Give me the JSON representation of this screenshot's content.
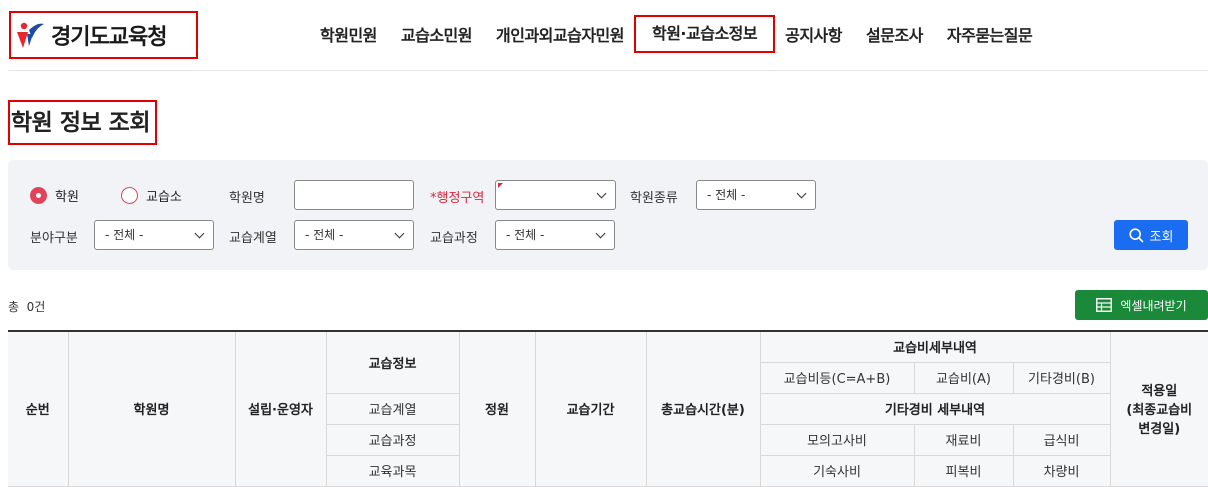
{
  "header": {
    "logo_text": "경기도교육청",
    "nav": [
      "학원민원",
      "교습소민원",
      "개인과외교습자민원",
      "학원·교습소정보",
      "공지사항",
      "설문조사",
      "자주묻는질문"
    ],
    "active_nav_index": 3
  },
  "page_title": "학원 정보 조회",
  "search": {
    "radio_academy": "학원",
    "radio_tutoring": "교습소",
    "selected_radio": "학원",
    "academy_name_label": "학원명",
    "academy_name_value": "",
    "district_label": "*행정구역",
    "district_value": "",
    "academy_type_label": "학원종류",
    "academy_type_value": "- 전체 -",
    "field_label": "분야구분",
    "field_value": "- 전체 -",
    "series_label": "교습계열",
    "series_value": "- 전체 -",
    "course_label": "교습과정",
    "course_value": "- 전체 -",
    "search_button": "조회"
  },
  "results": {
    "total_text": "총  0건",
    "excel_button": "엑셀내려받기"
  },
  "table_headers": {
    "no": "순번",
    "academy_name": "학원명",
    "founder": "설립·운영자",
    "tutoring_info": "교습정보",
    "tutoring_series": "교습계열",
    "tutoring_course": "교습과정",
    "subject": "교육과목",
    "capacity": "정원",
    "period": "교습기간",
    "total_hours": "총교습시간(분)",
    "fee_detail": "교습비세부내역",
    "fee_total": "교습비등(C=A+B)",
    "fee_a": "교습비(A)",
    "fee_b": "기타경비(B)",
    "other_fee_detail": "기타경비 세부내역",
    "mock_test": "모의고사비",
    "material": "재료비",
    "meal": "급식비",
    "dorm": "기숙사비",
    "clothes": "피복비",
    "vehicle": "차량비",
    "apply_date_1": "적용일",
    "apply_date_2": "(최종교습비",
    "apply_date_3": "변경일)"
  },
  "colors": {
    "highlight_border": "#e00000",
    "primary": "#1a6cf0",
    "excel": "#1a8a3a",
    "radio": "#e0445a"
  }
}
